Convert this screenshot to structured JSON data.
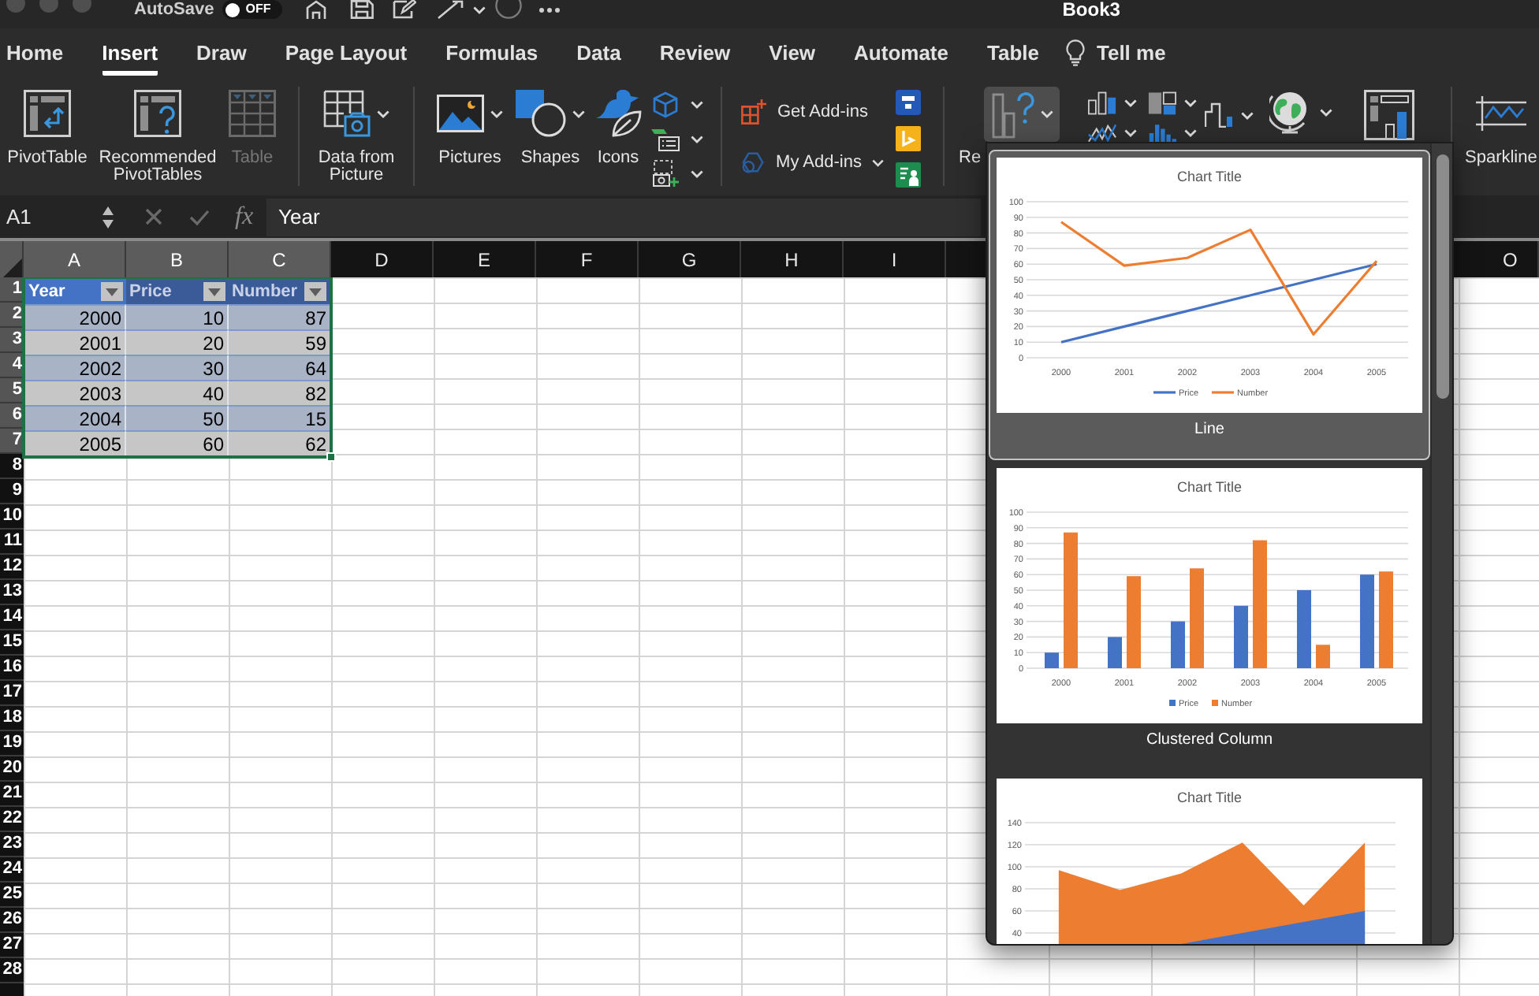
{
  "window": {
    "title": "Book3"
  },
  "autosave": {
    "label": "AutoSave",
    "on": false,
    "state_text": "OFF"
  },
  "tabs": [
    {
      "label": "Home",
      "selected": false
    },
    {
      "label": "Insert",
      "selected": true
    },
    {
      "label": "Draw",
      "selected": false
    },
    {
      "label": "Page Layout",
      "selected": false
    },
    {
      "label": "Formulas",
      "selected": false
    },
    {
      "label": "Data",
      "selected": false
    },
    {
      "label": "Review",
      "selected": false
    },
    {
      "label": "View",
      "selected": false
    },
    {
      "label": "Automate",
      "selected": false
    },
    {
      "label": "Table",
      "selected": false
    }
  ],
  "tell_me": {
    "label": "Tell me"
  },
  "ribbon": {
    "tables": [
      {
        "label": "PivotTable",
        "disabled": false
      },
      {
        "label": "Recommended PivotTables",
        "disabled": false
      },
      {
        "label": "Table",
        "disabled": true
      }
    ],
    "data_from_picture": {
      "label": "Data from Picture"
    },
    "illustrations": [
      {
        "label": "Pictures"
      },
      {
        "label": "Shapes"
      },
      {
        "label": "Icons"
      }
    ],
    "add_ins": [
      {
        "label": "Get Add-ins"
      },
      {
        "label": "My Add-ins"
      }
    ],
    "recommended_charts": {
      "label": "Re",
      "expanded": true
    },
    "sparklines": {
      "label": "Sparkline"
    }
  },
  "formula_bar": {
    "name_box": "A1",
    "function_label": "fx",
    "formula": "Year"
  },
  "sheet": {
    "column_headers": [
      {
        "label": "A",
        "selected": true
      },
      {
        "label": "B",
        "selected": true
      },
      {
        "label": "C",
        "selected": true
      },
      {
        "label": "D",
        "selected": false
      },
      {
        "label": "E",
        "selected": false
      },
      {
        "label": "F",
        "selected": false
      },
      {
        "label": "G",
        "selected": false
      },
      {
        "label": "H",
        "selected": false
      },
      {
        "label": "I",
        "selected": false
      },
      {
        "label": "O",
        "selected": false
      }
    ],
    "row_headers": [
      {
        "label": "1",
        "selected": true
      },
      {
        "label": "2",
        "selected": true
      },
      {
        "label": "3",
        "selected": true
      },
      {
        "label": "4",
        "selected": true
      },
      {
        "label": "5",
        "selected": true
      },
      {
        "label": "6",
        "selected": true
      },
      {
        "label": "7",
        "selected": true
      },
      {
        "label": "8",
        "selected": false
      },
      {
        "label": "9",
        "selected": false
      },
      {
        "label": "10",
        "selected": false
      },
      {
        "label": "11",
        "selected": false
      },
      {
        "label": "12",
        "selected": false
      },
      {
        "label": "13",
        "selected": false
      },
      {
        "label": "14",
        "selected": false
      },
      {
        "label": "15",
        "selected": false
      },
      {
        "label": "16",
        "selected": false
      },
      {
        "label": "17",
        "selected": false
      },
      {
        "label": "18",
        "selected": false
      },
      {
        "label": "19",
        "selected": false
      },
      {
        "label": "20",
        "selected": false
      },
      {
        "label": "21",
        "selected": false
      },
      {
        "label": "22",
        "selected": false
      },
      {
        "label": "23",
        "selected": false
      },
      {
        "label": "24",
        "selected": false
      },
      {
        "label": "25",
        "selected": false
      },
      {
        "label": "26",
        "selected": false
      },
      {
        "label": "27",
        "selected": false
      },
      {
        "label": "28",
        "selected": false
      }
    ],
    "table": {
      "selected": true,
      "columns": [
        {
          "label": "Year",
          "active": true
        },
        {
          "label": "Price",
          "active": false
        },
        {
          "label": "Number",
          "active": false
        }
      ],
      "rows": [
        [
          "2000",
          "10",
          "87"
        ],
        [
          "2001",
          "20",
          "59"
        ],
        [
          "2002",
          "30",
          "64"
        ],
        [
          "2003",
          "40",
          "82"
        ],
        [
          "2004",
          "50",
          "15"
        ],
        [
          "2005",
          "60",
          "62"
        ]
      ]
    }
  },
  "chart_menu": {
    "items": [
      {
        "label": "Line",
        "selected": true,
        "chart_data": {
          "type": "line",
          "title": "Chart Title",
          "grid": true,
          "legend": "bottom",
          "categories": [
            "2000",
            "2001",
            "2002",
            "2003",
            "2004",
            "2005"
          ],
          "series": [
            {
              "name": "Price",
              "color": "#4472c4",
              "values": [
                10,
                20,
                30,
                40,
                50,
                60
              ]
            },
            {
              "name": "Number",
              "color": "#ed7d31",
              "values": [
                87,
                59,
                64,
                82,
                15,
                62
              ]
            }
          ],
          "ylim": [
            0,
            100
          ],
          "yticks": [
            0,
            10,
            20,
            30,
            40,
            50,
            60,
            70,
            80,
            90,
            100
          ]
        }
      },
      {
        "label": "Clustered Column",
        "selected": false,
        "chart_data": {
          "type": "bar",
          "title": "Chart Title",
          "grid": true,
          "legend": "bottom",
          "categories": [
            "2000",
            "2001",
            "2002",
            "2003",
            "2004",
            "2005"
          ],
          "series": [
            {
              "name": "Price",
              "color": "#4472c4",
              "values": [
                10,
                20,
                30,
                40,
                50,
                60
              ]
            },
            {
              "name": "Number",
              "color": "#ed7d31",
              "values": [
                87,
                59,
                64,
                82,
                15,
                62
              ]
            }
          ],
          "ylim": [
            0,
            100
          ],
          "yticks": [
            0,
            10,
            20,
            30,
            40,
            50,
            60,
            70,
            80,
            90,
            100
          ]
        }
      },
      {
        "selected": false,
        "chart_data": {
          "type": "area",
          "title": "Chart Title",
          "grid": true,
          "categories": [
            null,
            null,
            null,
            null,
            null,
            null
          ],
          "series": [
            {
              "color": "#ed7d31",
              "values": [
                97,
                79,
                94,
                122,
                65,
                122
              ]
            },
            {
              "color": "#4472c4",
              "values": [
                null,
                null,
                30,
                40,
                50,
                60
              ]
            }
          ],
          "ylim": [
            30,
            140
          ],
          "yticks": [
            40,
            60,
            80,
            100,
            120,
            140
          ]
        }
      }
    ]
  }
}
